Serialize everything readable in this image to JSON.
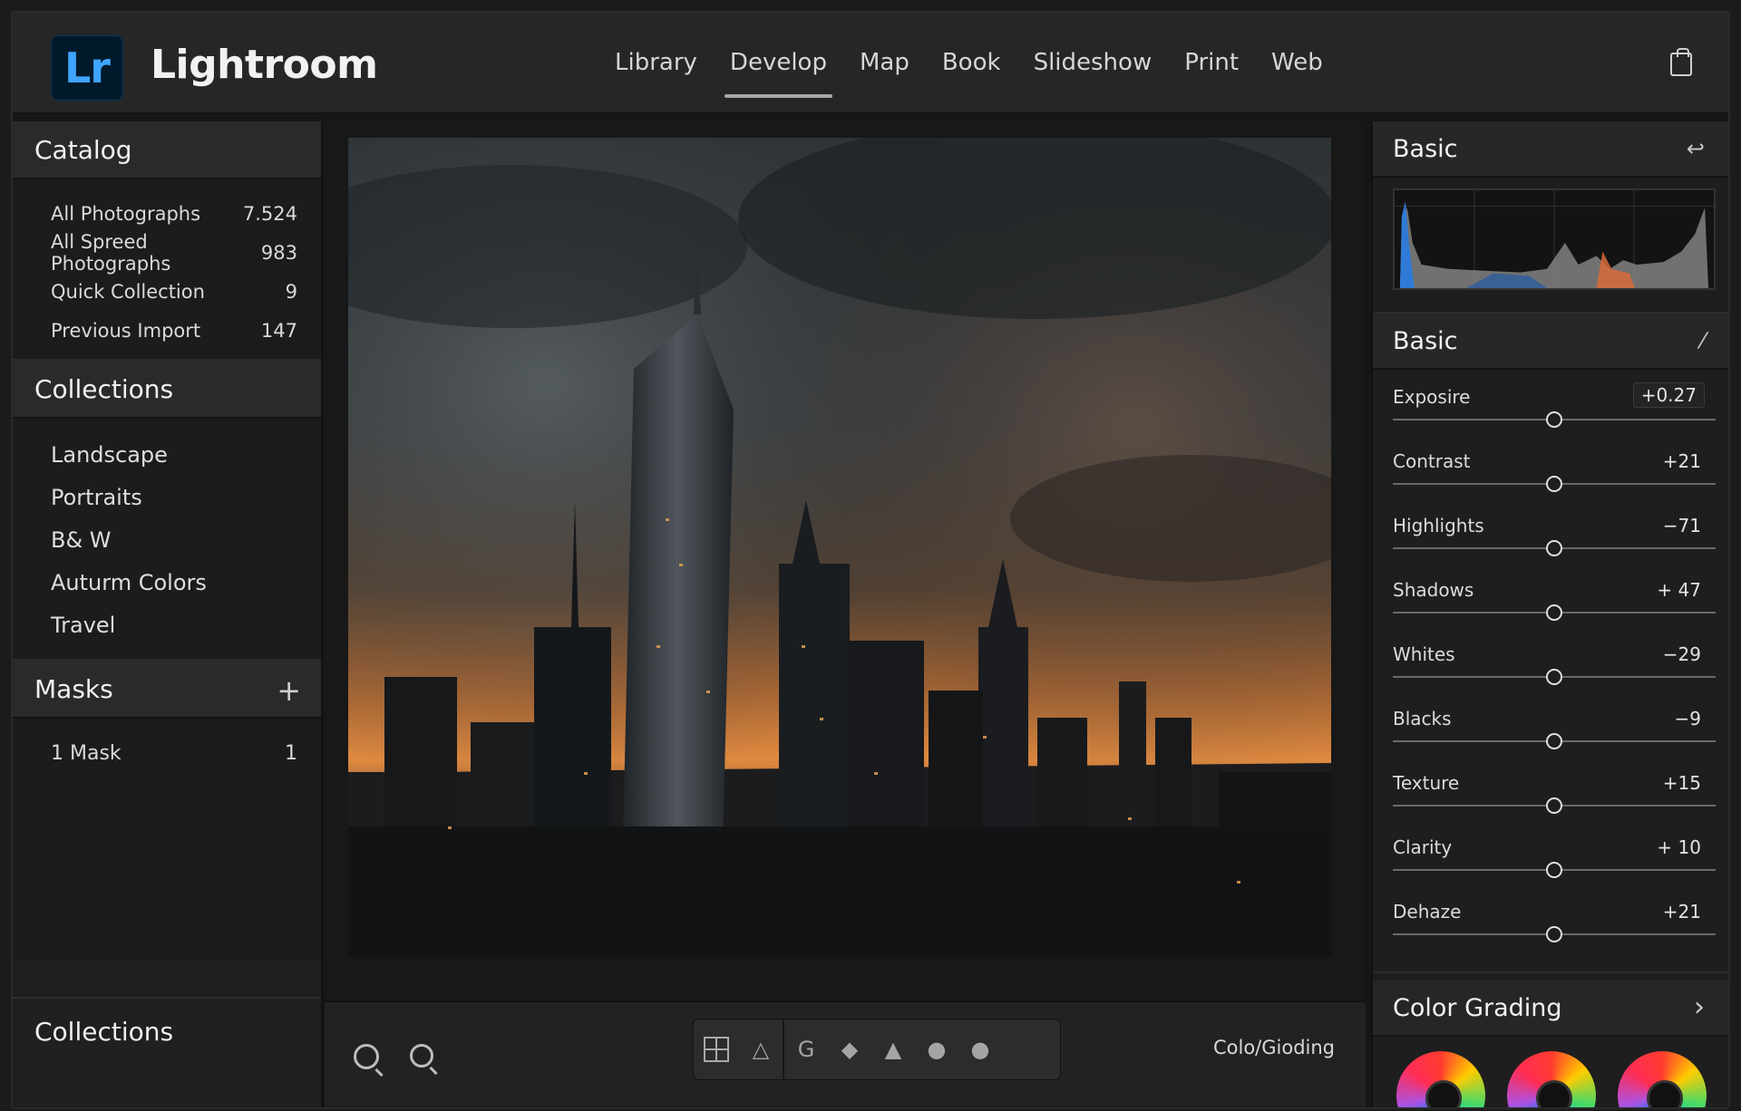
{
  "app": {
    "logo": "Lr",
    "name": "Lightroom"
  },
  "modules": [
    "Library",
    "Develop",
    "Map",
    "Book",
    "Slideshow",
    "Print",
    "Web"
  ],
  "active_module": "Develop",
  "left_panel": {
    "catalog_title": "Catalog",
    "catalog_items": [
      {
        "label": "All Photographs",
        "count": "7.524"
      },
      {
        "label": "All Spreed Photographs",
        "count": "983"
      },
      {
        "label": "Quick Collection",
        "count": "9"
      },
      {
        "label": "Previous Import",
        "count": "147"
      }
    ],
    "collections_title": "Collections",
    "collections": [
      "Landscape",
      "Portraits",
      "B& W",
      "Auturm Colors",
      "Travel"
    ],
    "masks_title": "Masks",
    "masks_add": "+",
    "masks": [
      {
        "label": "1 Mask",
        "count": "1"
      }
    ],
    "bottom_title": "Collections"
  },
  "toolbar": {
    "label": "Colo/Gioding"
  },
  "right_panel": {
    "histogram_title": "Basic",
    "basic_title": "Basic",
    "sliders": [
      {
        "label": "Exposire",
        "value": "+0.27",
        "level": 0.5
      },
      {
        "label": "Contrast",
        "value": "+21",
        "level": 0.5
      },
      {
        "label": "Highlights",
        "value": "−71",
        "level": 0.5
      },
      {
        "label": "Shadows",
        "value": "+ 47",
        "level": 0.5
      },
      {
        "label": "Whites",
        "value": "−29",
        "level": 0.5
      },
      {
        "label": "Blacks",
        "value": "−9",
        "level": 0.5
      },
      {
        "label": "Texture",
        "value": "+15",
        "level": 0.5
      },
      {
        "label": "Clarity",
        "value": "+ 10",
        "level": 0.5
      },
      {
        "label": "Dehaze",
        "value": "+21",
        "level": 0.5
      }
    ],
    "color_grading_title": "Color Grading"
  },
  "colors": {
    "logo_bg": "#001a2c",
    "logo_text": "#3fa5ff",
    "panel": "#1e1e1e"
  }
}
